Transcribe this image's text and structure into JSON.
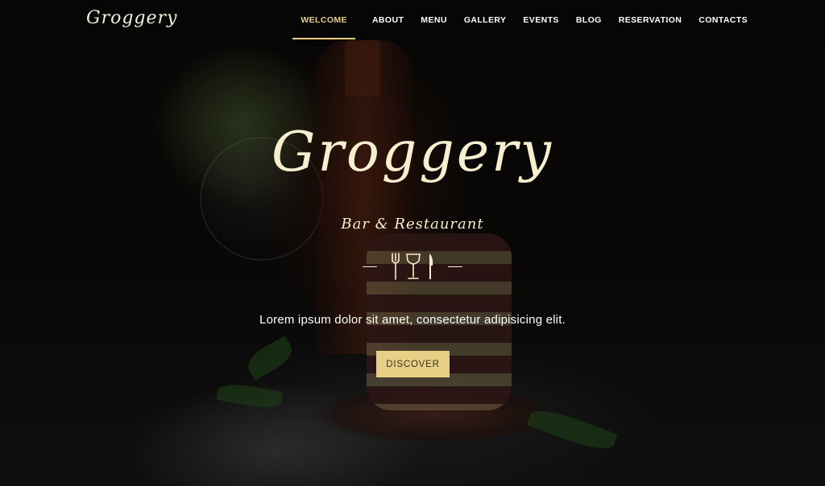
{
  "brand": {
    "logo": "Groggery"
  },
  "nav": {
    "items": [
      {
        "label": "WELCOME",
        "active": true
      },
      {
        "label": "ABOUT"
      },
      {
        "label": "MENU"
      },
      {
        "label": "GALLERY"
      },
      {
        "label": "EVENTS"
      },
      {
        "label": "BLOG"
      },
      {
        "label": "RESERVATION"
      },
      {
        "label": "CONTACTS"
      }
    ]
  },
  "hero": {
    "title": "Groggery",
    "subtitle": "Bar & Restaurant",
    "description": "Lorem ipsum dolor sit amet, consectetur adipisicing elit.",
    "button_label": "DISCOVER",
    "divider_icons": [
      "fork-icon",
      "wine-glass-icon",
      "knife-icon"
    ]
  },
  "colors": {
    "accent": "#e8cf86",
    "title_text": "#f7efcf",
    "background": "#0b0a09"
  }
}
